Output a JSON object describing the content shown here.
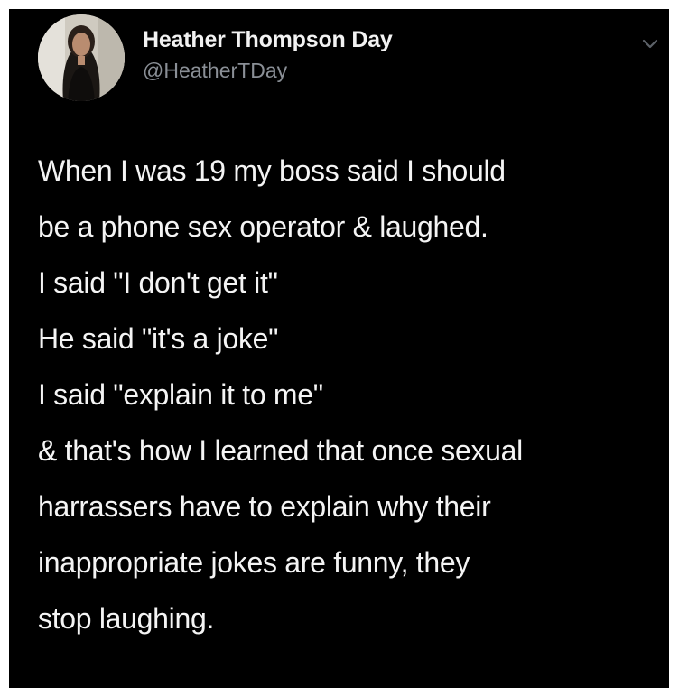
{
  "tweet": {
    "author": {
      "display_name": "Heather Thompson Day",
      "handle": "@HeatherTDay",
      "avatar_icon": "profile-photo"
    },
    "menu_icon": "chevron-down-icon",
    "text_lines": [
      "When I was 19 my boss said I should",
      "be a phone sex operator & laughed.",
      "I said \"I don't get it\"",
      "He said \"it's a joke\"",
      "I said \"explain it to me\"",
      "& that's how I learned that once sexual",
      "harrassers have to explain why their",
      "inappropriate jokes are funny, they",
      "stop laughing."
    ]
  },
  "colors": {
    "background": "#000000",
    "text": "#f4f4f4",
    "handle": "#8a8f96",
    "page_border": "#ffffff"
  }
}
